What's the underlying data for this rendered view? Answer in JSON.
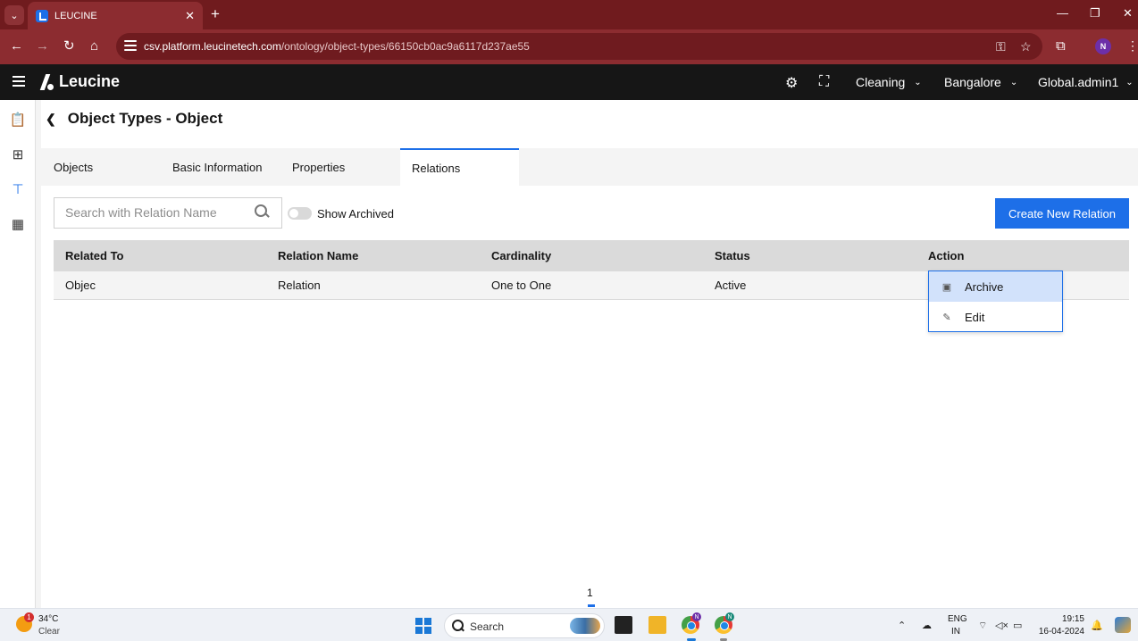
{
  "browser": {
    "tab_title": "LEUCINE",
    "url_host": "csv.platform.leucinetech.com",
    "url_path": "/ontology/object-types/66150cb0ac9a6117d237ae55",
    "profile_initial": "N"
  },
  "header": {
    "brand": "Leucine",
    "facility_dropdown": "Cleaning",
    "site_dropdown": "Bangalore",
    "user_dropdown": "Global.admin1"
  },
  "page": {
    "title": "Object Types - Object",
    "tabs": [
      {
        "label": "Objects",
        "active": false
      },
      {
        "label": "Basic Information",
        "active": false
      },
      {
        "label": "Properties",
        "active": false
      },
      {
        "label": "Relations",
        "active": true
      }
    ],
    "search_placeholder": "Search with Relation Name",
    "show_archived_label": "Show Archived",
    "show_archived_on": false,
    "create_button": "Create New Relation"
  },
  "table": {
    "columns": [
      "Related To",
      "Relation Name",
      "Cardinality",
      "Status",
      "Action"
    ],
    "rows": [
      {
        "related_to": "Objec",
        "relation_name": "Relation",
        "cardinality": "One to One",
        "status": "Active"
      }
    ]
  },
  "action_menu": {
    "items": [
      {
        "label": "Archive",
        "icon": "archive-icon"
      },
      {
        "label": "Edit",
        "icon": "pencil-icon"
      }
    ]
  },
  "pagination": {
    "current": "1"
  },
  "taskbar": {
    "weather_temp": "34°C",
    "weather_desc": "Clear",
    "weather_badge": "1",
    "search_label": "Search",
    "lang_line1": "ENG",
    "lang_line2": "IN",
    "time": "19:15",
    "date": "16-04-2024"
  },
  "colors": {
    "accent": "#1d6fe8",
    "browser_frame": "#8c2c30",
    "app_header": "#161616"
  }
}
